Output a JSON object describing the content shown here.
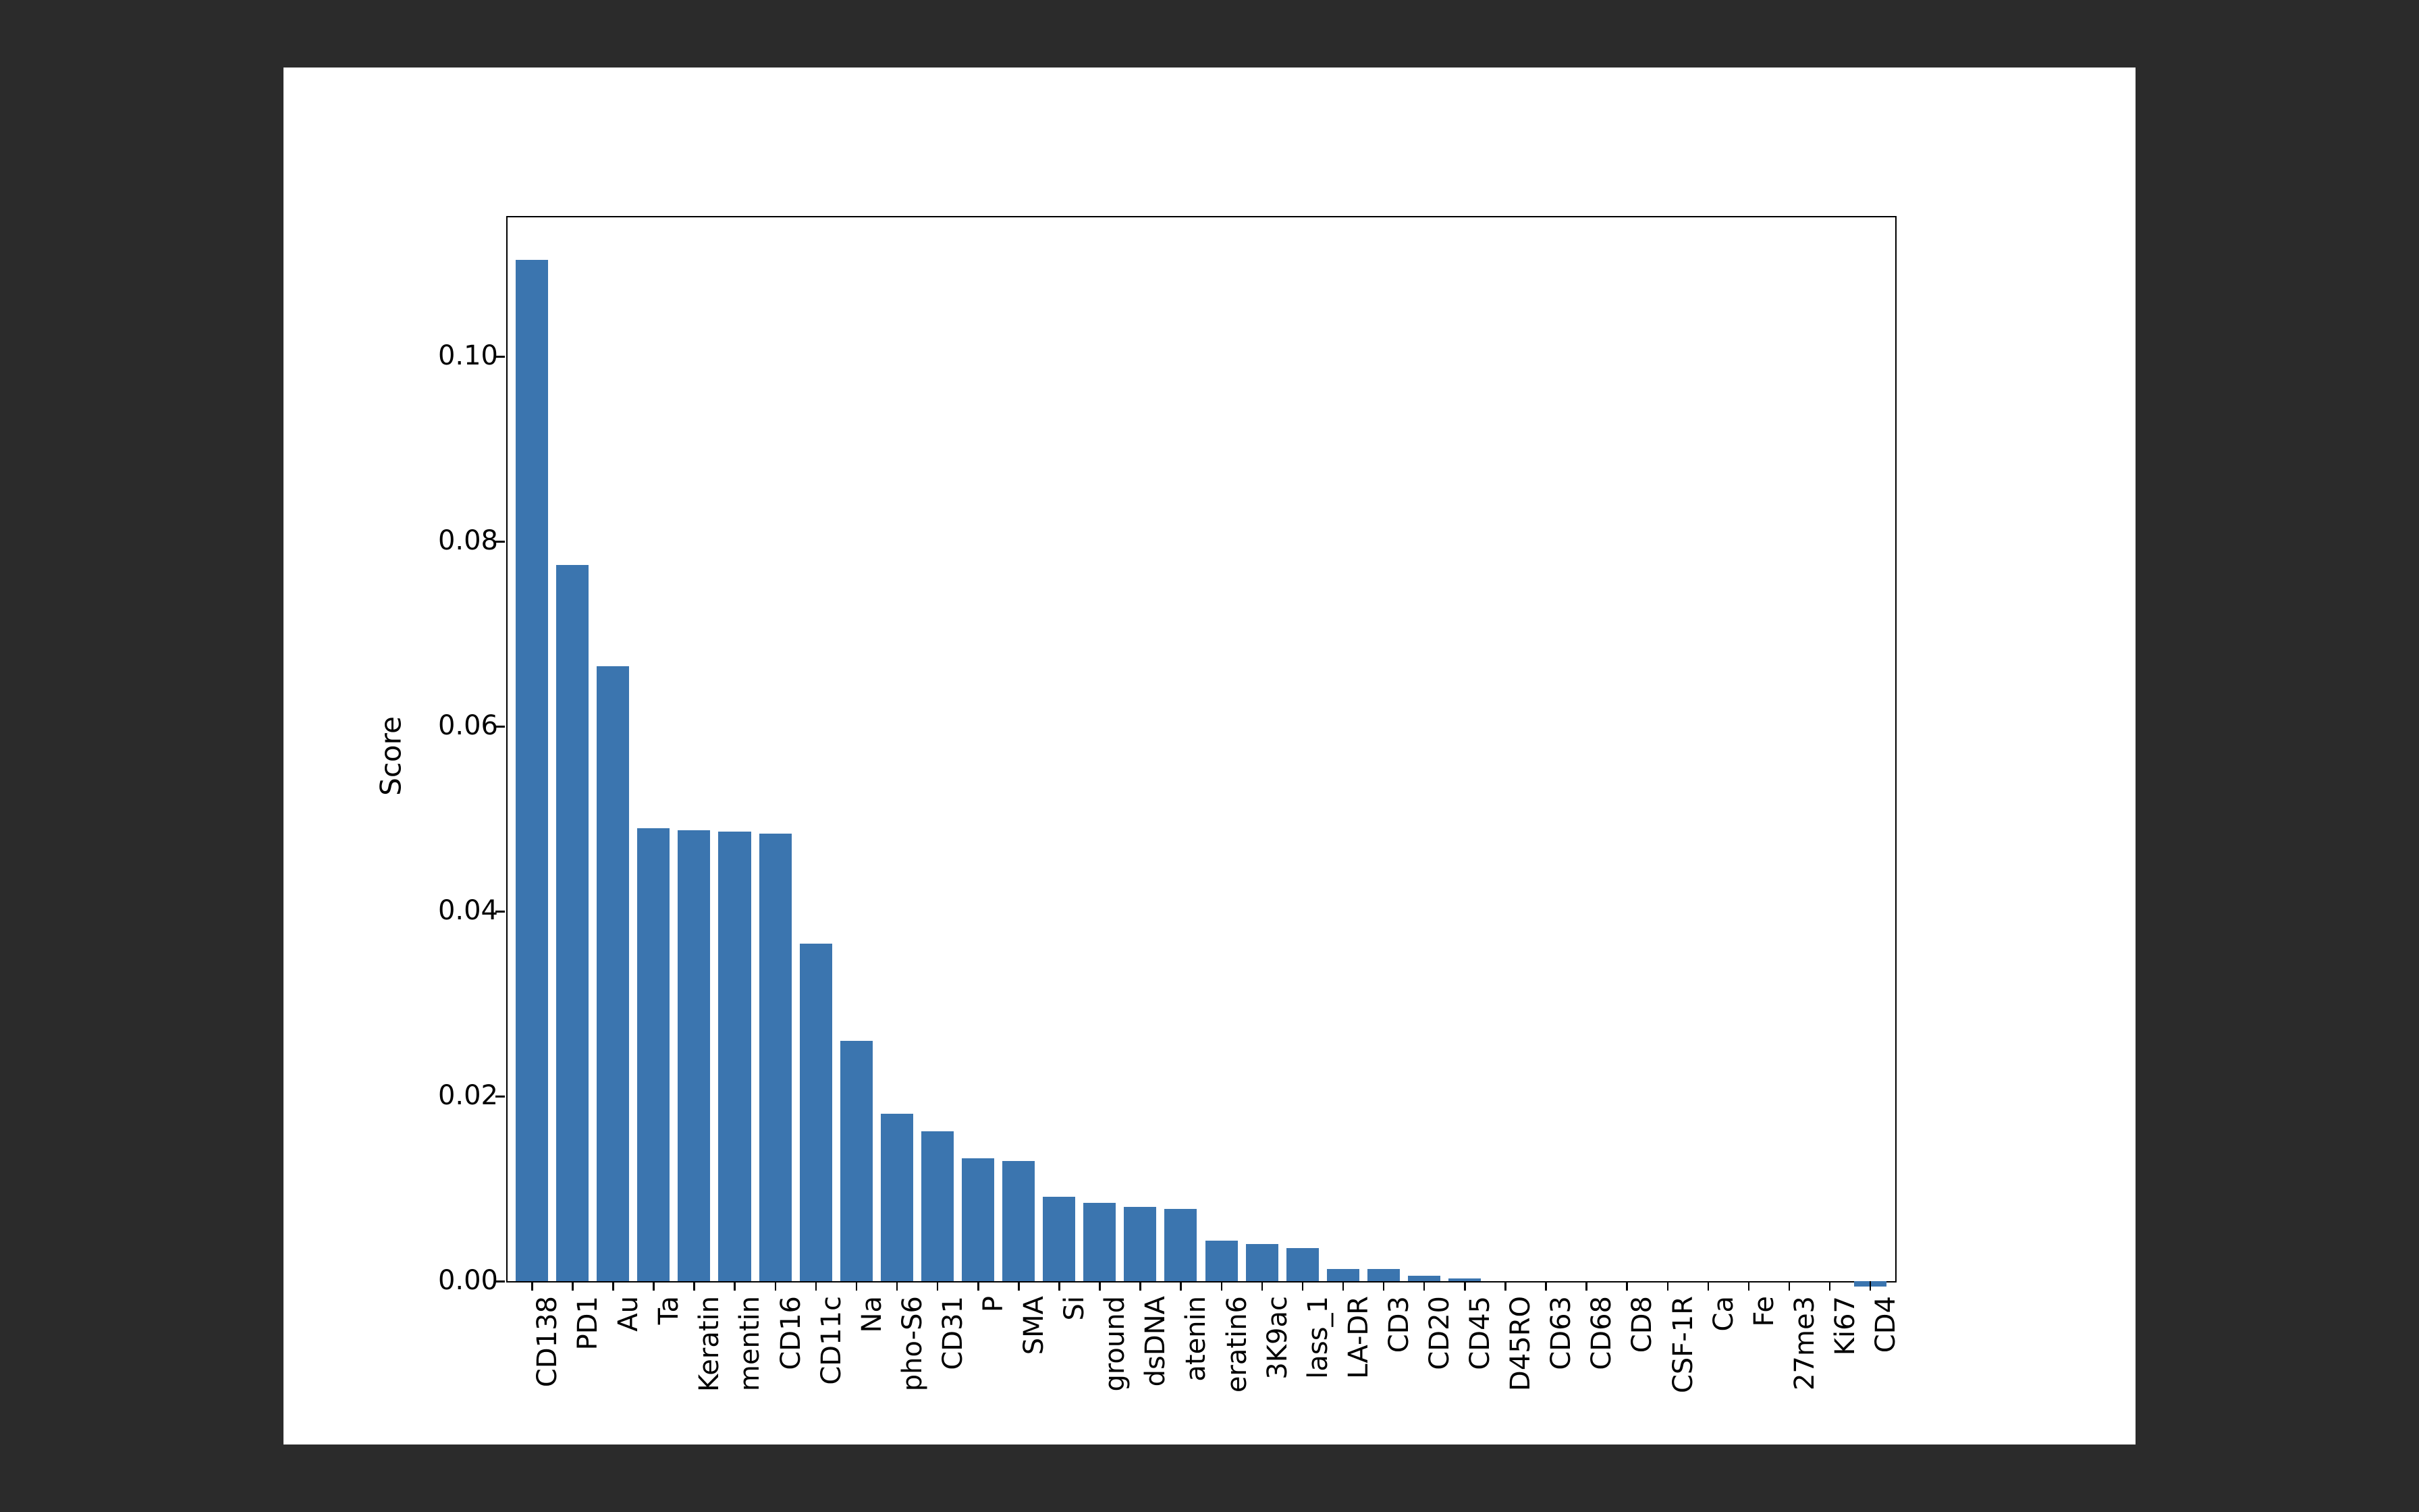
{
  "chart_data": {
    "type": "bar",
    "ylabel": "Score",
    "ylim": [
      0,
      0.115
    ],
    "yticks": [
      0.0,
      0.02,
      0.04,
      0.06,
      0.08,
      0.1
    ],
    "ytick_labels": [
      "0.00",
      "0.02",
      "0.04",
      "0.06",
      "0.08",
      "0.10"
    ],
    "categories": [
      "CD138",
      "PD1",
      "Au",
      "Ta",
      "Keratin",
      "mentin",
      "CD16",
      "CD11c",
      "Na",
      "pho-S6",
      "CD31",
      "P",
      "SMA",
      "Si",
      "ground",
      "dsDNA",
      "atenin",
      "eratin6",
      "3K9ac",
      "lass_1",
      "LA-DR",
      "CD3",
      "CD20",
      "CD45",
      "D45RO",
      "CD63",
      "CD68",
      "CD8",
      "CSF-1R",
      "Ca",
      "Fe",
      "27me3",
      "Ki67",
      "CD4"
    ],
    "values": [
      0.1105,
      0.0775,
      0.0665,
      0.049,
      0.0488,
      0.0486,
      0.0484,
      0.0365,
      0.026,
      0.0181,
      0.0162,
      0.0133,
      0.013,
      0.0091,
      0.0085,
      0.008,
      0.0078,
      0.0044,
      0.004,
      0.0036,
      0.0013,
      0.0013,
      0.0006,
      0.0003,
      0.0,
      0.0,
      0.0,
      0.0,
      0.0,
      0.0,
      0.0,
      0.0,
      0.0,
      -0.0006
    ],
    "bar_color": "#3b75af"
  }
}
